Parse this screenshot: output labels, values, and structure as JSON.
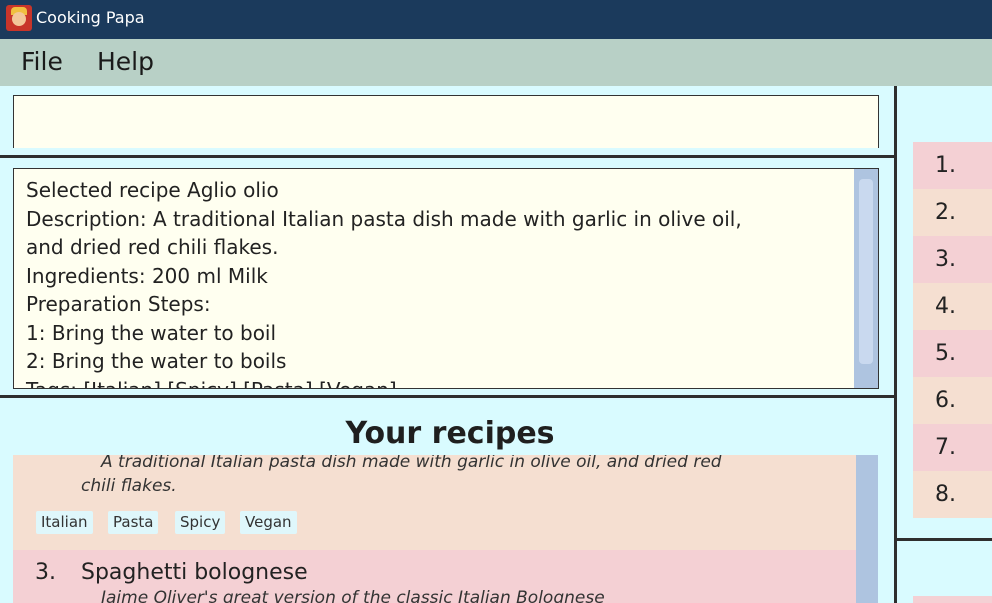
{
  "window": {
    "title": "Cooking Papa"
  },
  "menu": {
    "file": "File",
    "help": "Help"
  },
  "command": {
    "value": ""
  },
  "result": {
    "lines": [
      "Selected recipe Aglio olio",
      "Description: A traditional Italian pasta dish made with garlic in olive oil,",
      "and dried red chili flakes.",
      "Ingredients: 200 ml Milk",
      "Preparation Steps:",
      "1: Bring the water to boil",
      "2: Bring the water to boils",
      "Tags: [Italian] [Spicy] [Pasta] [Vegan]"
    ]
  },
  "recipes": {
    "title": "Your recipes",
    "card1": {
      "desc_line1": "A traditional Italian pasta dish made with garlic in olive oil, and dried red",
      "desc_line2": "chili flakes.",
      "tags": [
        "Italian",
        "Pasta",
        "Spicy",
        "Vegan"
      ]
    },
    "card2": {
      "number": "3.",
      "name": "Spaghetti bolognese",
      "desc": "Jaime Oliver's great version of the classic Italian Bolognese"
    }
  },
  "side_list": [
    "1.",
    "2.",
    "3.",
    "4.",
    "5.",
    "6.",
    "7.",
    "8."
  ],
  "colors": {
    "pink": "#f4d0d4",
    "peach": "#f5dfd1",
    "title_bar": "#1b3a5c",
    "menu_bar": "#b8d0c6"
  }
}
